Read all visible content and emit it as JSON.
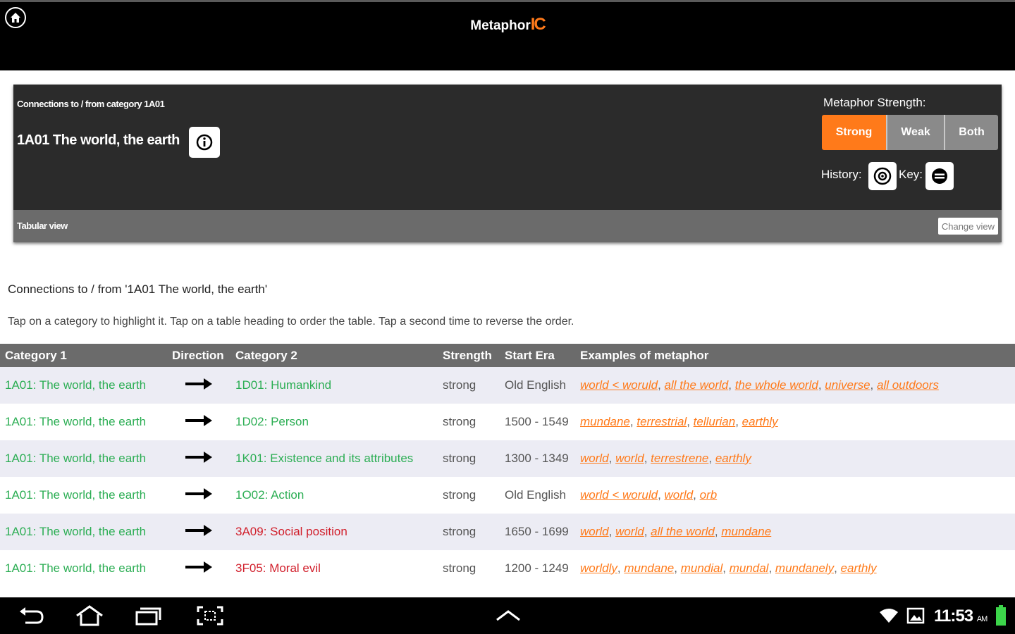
{
  "app": {
    "title": "Metaphor",
    "brand_ic": "IC"
  },
  "panel": {
    "kicker": "Connections to / from category 1A01",
    "category_title": "1A01 The world, the earth",
    "strength_label": "Metaphor Strength:",
    "strength_options": [
      "Strong",
      "Weak",
      "Both"
    ],
    "strength_selected": "Strong",
    "history_label": "History:",
    "key_label": "Key:",
    "view_label": "Tabular view",
    "change_view_label": "Change view"
  },
  "content": {
    "heading": "Connections to / from '1A01 The world, the earth'",
    "instructions": "Tap on a category to highlight it. Tap on a table heading to order the table. Tap a second time to reverse the order."
  },
  "table": {
    "headers": [
      "Category 1",
      "Direction",
      "Category 2",
      "Strength",
      "Start Era",
      "Examples of metaphor"
    ],
    "rows": [
      {
        "cat1": "1A01: The world, the earth",
        "cat2": "1D01: Humankind",
        "cat2_color": "green",
        "strength": "strong",
        "era": "Old English",
        "examples": [
          "world < woruld",
          "all the world",
          "the whole world",
          "universe",
          "all outdoors"
        ]
      },
      {
        "cat1": "1A01: The world, the earth",
        "cat2": "1D02: Person",
        "cat2_color": "green",
        "strength": "strong",
        "era": "1500 - 1549",
        "examples": [
          "mundane",
          "terrestrial",
          "tellurian",
          "earthly"
        ]
      },
      {
        "cat1": "1A01: The world, the earth",
        "cat2": "1K01: Existence and its attributes",
        "cat2_color": "green",
        "strength": "strong",
        "era": "1300 - 1349",
        "examples": [
          "world",
          "world",
          "terrestrene",
          "earthly"
        ]
      },
      {
        "cat1": "1A01: The world, the earth",
        "cat2": "1O02: Action",
        "cat2_color": "green",
        "strength": "strong",
        "era": "Old English",
        "examples": [
          "world < woruld",
          "world",
          "orb"
        ]
      },
      {
        "cat1": "1A01: The world, the earth",
        "cat2": "3A09: Social position",
        "cat2_color": "red",
        "strength": "strong",
        "era": "1650 - 1699",
        "examples": [
          "world",
          "world",
          "all the world",
          "mundane"
        ]
      },
      {
        "cat1": "1A01: The world, the earth",
        "cat2": "3F05: Moral evil",
        "cat2_color": "red",
        "strength": "strong",
        "era": "1200 - 1249",
        "examples": [
          "worldly",
          "mundane",
          "mundial",
          "mundal",
          "mundanely",
          "earthly"
        ]
      }
    ]
  },
  "statusbar": {
    "time": "11:53",
    "ampm": "AM"
  },
  "colors": {
    "accent": "#ff7a1a",
    "green": "#2cae54",
    "red": "#d11f2b"
  }
}
